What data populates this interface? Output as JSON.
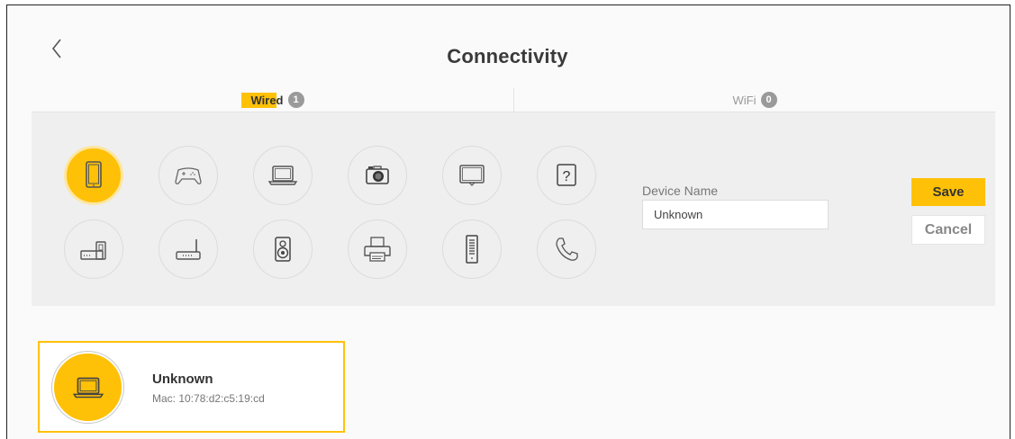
{
  "header": {
    "title": "Connectivity",
    "back_icon": "chevron-left-icon"
  },
  "tabs": [
    {
      "label": "Wired",
      "count": "1",
      "active": true
    },
    {
      "label": "WiFi",
      "count": "0",
      "active": false
    }
  ],
  "device_types": [
    {
      "name": "tablet-icon",
      "selected": true
    },
    {
      "name": "game-controller-icon",
      "selected": false
    },
    {
      "name": "laptop-icon",
      "selected": false
    },
    {
      "name": "camera-icon",
      "selected": false
    },
    {
      "name": "monitor-icon",
      "selected": false
    },
    {
      "name": "question-icon",
      "selected": false
    },
    {
      "name": "modem-icon",
      "selected": false
    },
    {
      "name": "router-icon",
      "selected": false
    },
    {
      "name": "speaker-icon",
      "selected": false
    },
    {
      "name": "printer-icon",
      "selected": false
    },
    {
      "name": "tower-server-icon",
      "selected": false
    },
    {
      "name": "phone-icon",
      "selected": false
    }
  ],
  "form": {
    "device_name_label": "Device Name",
    "device_name_value": "Unknown",
    "save_label": "Save",
    "cancel_label": "Cancel"
  },
  "devices": [
    {
      "name": "Unknown",
      "mac": "Mac: 10:78:d2:c5:19:cd",
      "icon": "laptop-icon"
    }
  ],
  "colors": {
    "accent": "#ffc107",
    "panel": "#efefef",
    "badge": "#9a9a9a"
  }
}
